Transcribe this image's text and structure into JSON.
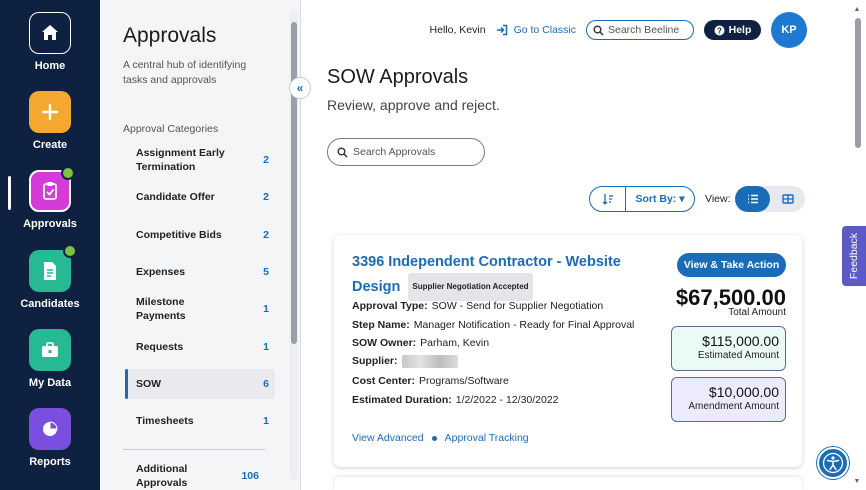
{
  "rail": {
    "items": [
      {
        "label": "Home"
      },
      {
        "label": "Create"
      },
      {
        "label": "Approvals"
      },
      {
        "label": "Candidates"
      },
      {
        "label": "My Data"
      },
      {
        "label": "Reports"
      }
    ]
  },
  "panel": {
    "title": "Approvals",
    "subtitle": "A central hub of identifying tasks and approvals",
    "section_label": "Approval Categories",
    "categories": [
      {
        "label": "Assignment Early Termination",
        "count": "2"
      },
      {
        "label": "Candidate Offer",
        "count": "2"
      },
      {
        "label": "Competitive Bids",
        "count": "2"
      },
      {
        "label": "Expenses",
        "count": "5"
      },
      {
        "label": "Milestone Payments",
        "count": "1"
      },
      {
        "label": "Requests",
        "count": "1"
      },
      {
        "label": "SOW",
        "count": "6"
      },
      {
        "label": "Timesheets",
        "count": "1"
      }
    ],
    "additional": {
      "label": "Additional Approvals",
      "count": "106"
    }
  },
  "topbar": {
    "greeting": "Hello, Kevin",
    "classic_link": "Go to Classic",
    "search_placeholder": "Search Beeline",
    "help_label": "Help",
    "avatar_initials": "KP"
  },
  "main": {
    "title": "SOW Approvals",
    "subtitle": "Review, approve and reject.",
    "search_placeholder": "Search Approvals",
    "sort_label": "Sort By:",
    "view_label": "View:"
  },
  "card": {
    "title": "3396 Independent Contractor - Website Design",
    "badge": "Supplier Negotiation Accepted",
    "fields": [
      {
        "label": "Approval Type:",
        "value": "SOW - Send for Supplier Negotiation"
      },
      {
        "label": "Step Name:",
        "value": "Manager Notification - Ready for Final Approval"
      },
      {
        "label": "SOW Owner:",
        "value": "Parham, Kevin"
      },
      {
        "label": "Supplier:",
        "value": ""
      },
      {
        "label": "Cost Center:",
        "value": "Programs/Software"
      },
      {
        "label": "Estimated Duration:",
        "value": "1/2/2022 - 12/30/2022"
      }
    ],
    "links": {
      "advanced": "View Advanced",
      "tracking": "Approval Tracking"
    },
    "action_label": "View & Take Action",
    "total_amount": "$67,500.00",
    "total_label": "Total Amount",
    "estimated_amount": "$115,000.00",
    "estimated_label": "Estimated Amount",
    "amendment_amount": "$10,000.00",
    "amendment_label": "Amendment Amount"
  },
  "feedback_label": "Feedback",
  "colors": {
    "rail": "#0f2141",
    "accent": "#1b6cb8",
    "status_dot": "#7cc242"
  }
}
